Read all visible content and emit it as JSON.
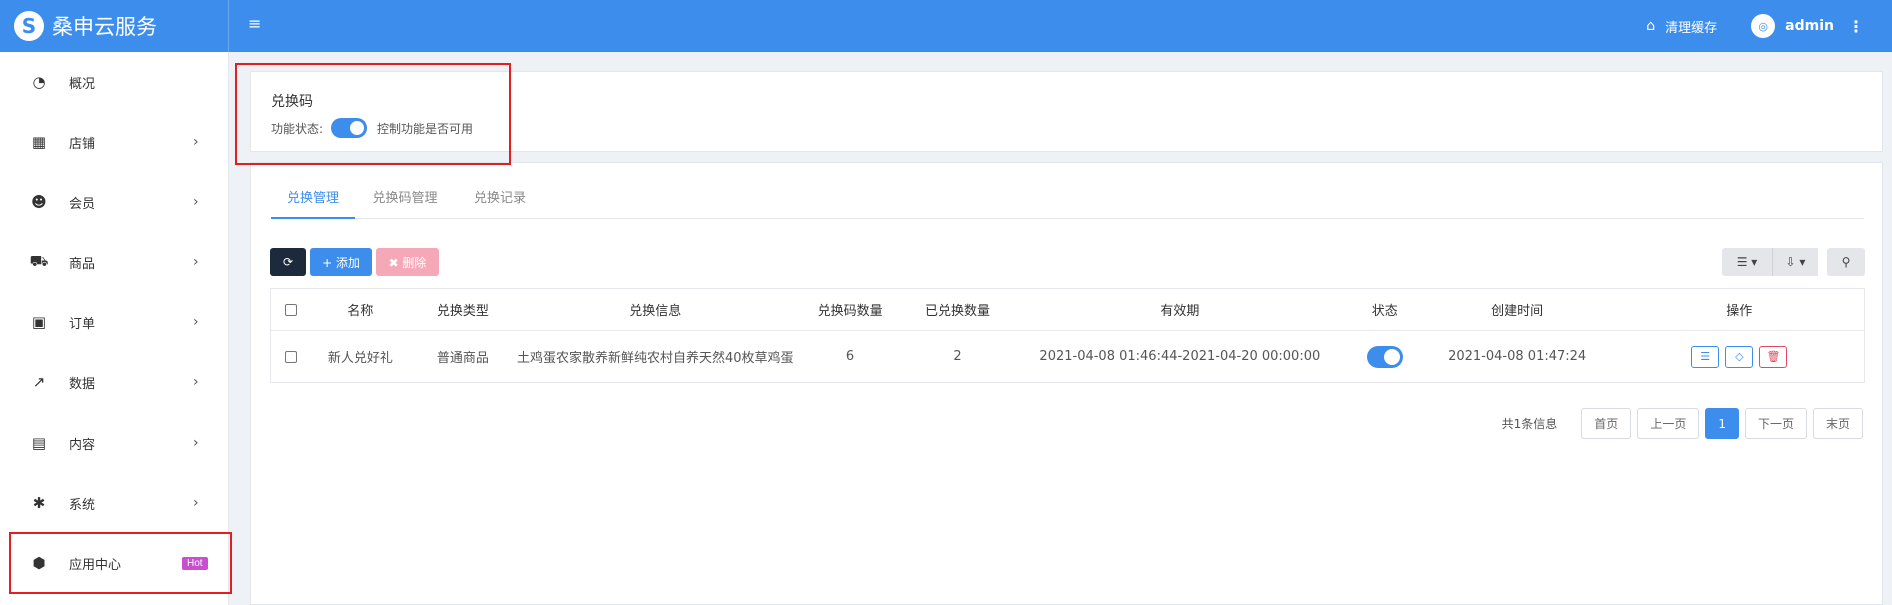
{
  "brand": {
    "logo_glyph": "S",
    "name": "桑申云服务"
  },
  "header": {
    "menu_icon": "≡",
    "clear_cache_icon": "⌂",
    "clear_cache_label": "清理缓存",
    "avatar_glyph": "◎",
    "user_name": "admin",
    "more_icon": "⋮"
  },
  "sidebar": {
    "items": [
      {
        "icon": "◔",
        "label": "概况",
        "chevron": ""
      },
      {
        "icon": "▦",
        "label": "店铺",
        "chevron": "›"
      },
      {
        "icon": "☻",
        "label": "会员",
        "chevron": "›"
      },
      {
        "icon": "⛟",
        "label": "商品",
        "chevron": "›"
      },
      {
        "icon": "▣",
        "label": "订单",
        "chevron": "›"
      },
      {
        "icon": "↗",
        "label": "数据",
        "chevron": "›"
      },
      {
        "icon": "▤",
        "label": "内容",
        "chevron": "›"
      },
      {
        "icon": "✱",
        "label": "系统",
        "chevron": "›"
      },
      {
        "icon": "⬢",
        "label": "应用中心",
        "badge": "Hot"
      }
    ]
  },
  "feature": {
    "title": "兑换码",
    "status_label": "功能状态:",
    "status_desc": "控制功能是否可用"
  },
  "tabs": [
    "兑换管理",
    "兑换码管理",
    "兑换记录"
  ],
  "toolbar": {
    "refresh_icon": "⟳",
    "add_label": "+ 添加",
    "delete_label": "✖ 删除",
    "columns_icon": "☰ ▾",
    "export_icon": "⇩ ▾",
    "search_icon": "⚲"
  },
  "table": {
    "columns": [
      "名称",
      "兑换类型",
      "兑换信息",
      "兑换码数量",
      "已兑换数量",
      "有效期",
      "状态",
      "创建时间",
      "操作"
    ],
    "rows": [
      {
        "name": "新人兑好礼",
        "type": "普通商品",
        "info": "土鸡蛋农家散养新鲜纯农村自养天然40枚草鸡蛋",
        "code_count": "6",
        "redeemed_count": "2",
        "validity": "2021-04-08 01:46:44-2021-04-20 00:00:00",
        "created_at": "2021-04-08 01:47:24",
        "op_list_icon": "☰",
        "op_gem_icon": "◇",
        "op_delete_icon": "🗑"
      }
    ]
  },
  "pagination": {
    "total_text": "共1条信息",
    "first": "首页",
    "prev": "上一页",
    "current": "1",
    "next": "下一页",
    "last": "末页"
  }
}
